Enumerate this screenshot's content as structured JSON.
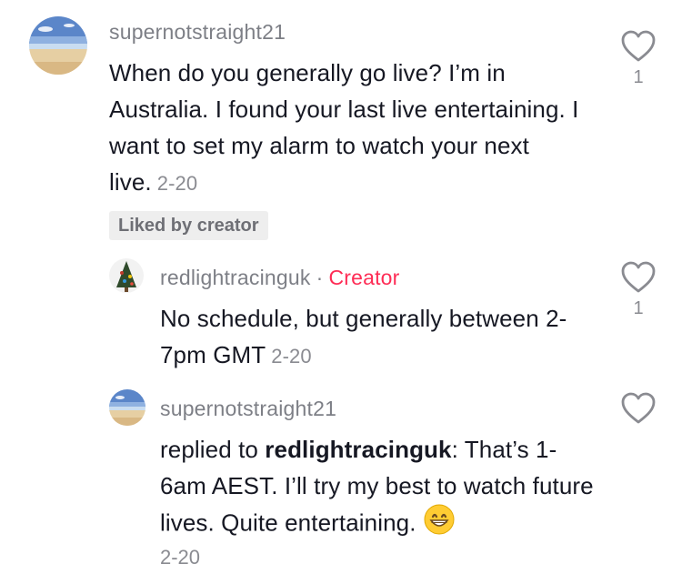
{
  "comments": [
    {
      "username": "supernotstraight21",
      "text": "When do you generally go live? I’m in Australia. I found your last live entertaining. I want to set my alarm to watch your next live.",
      "date": "2-20",
      "liked_badge": "Liked by creator",
      "like_count": "1",
      "avatar_icon": "beach-avatar"
    },
    {
      "username": "redlightracinguk",
      "separator": "·",
      "creator_label": "Creator",
      "text": "No schedule, but generally between 2-7pm GMT",
      "date": "2-20",
      "like_count": "1",
      "avatar_icon": "tree-avatar"
    },
    {
      "username": "supernotstraight21",
      "reply_prefix": "replied to",
      "reply_target": "redlightracinguk",
      "text": ": That’s 1-6am AEST. I’ll try my best to watch future lives. Quite entertaining.",
      "emoji": "grinning-face-emoji",
      "date": "2-20",
      "avatar_icon": "beach-avatar"
    }
  ],
  "colors": {
    "creator": "#fe2c55",
    "username": "#7d7f86",
    "text": "#161823",
    "badge_bg": "#eeeeee"
  }
}
